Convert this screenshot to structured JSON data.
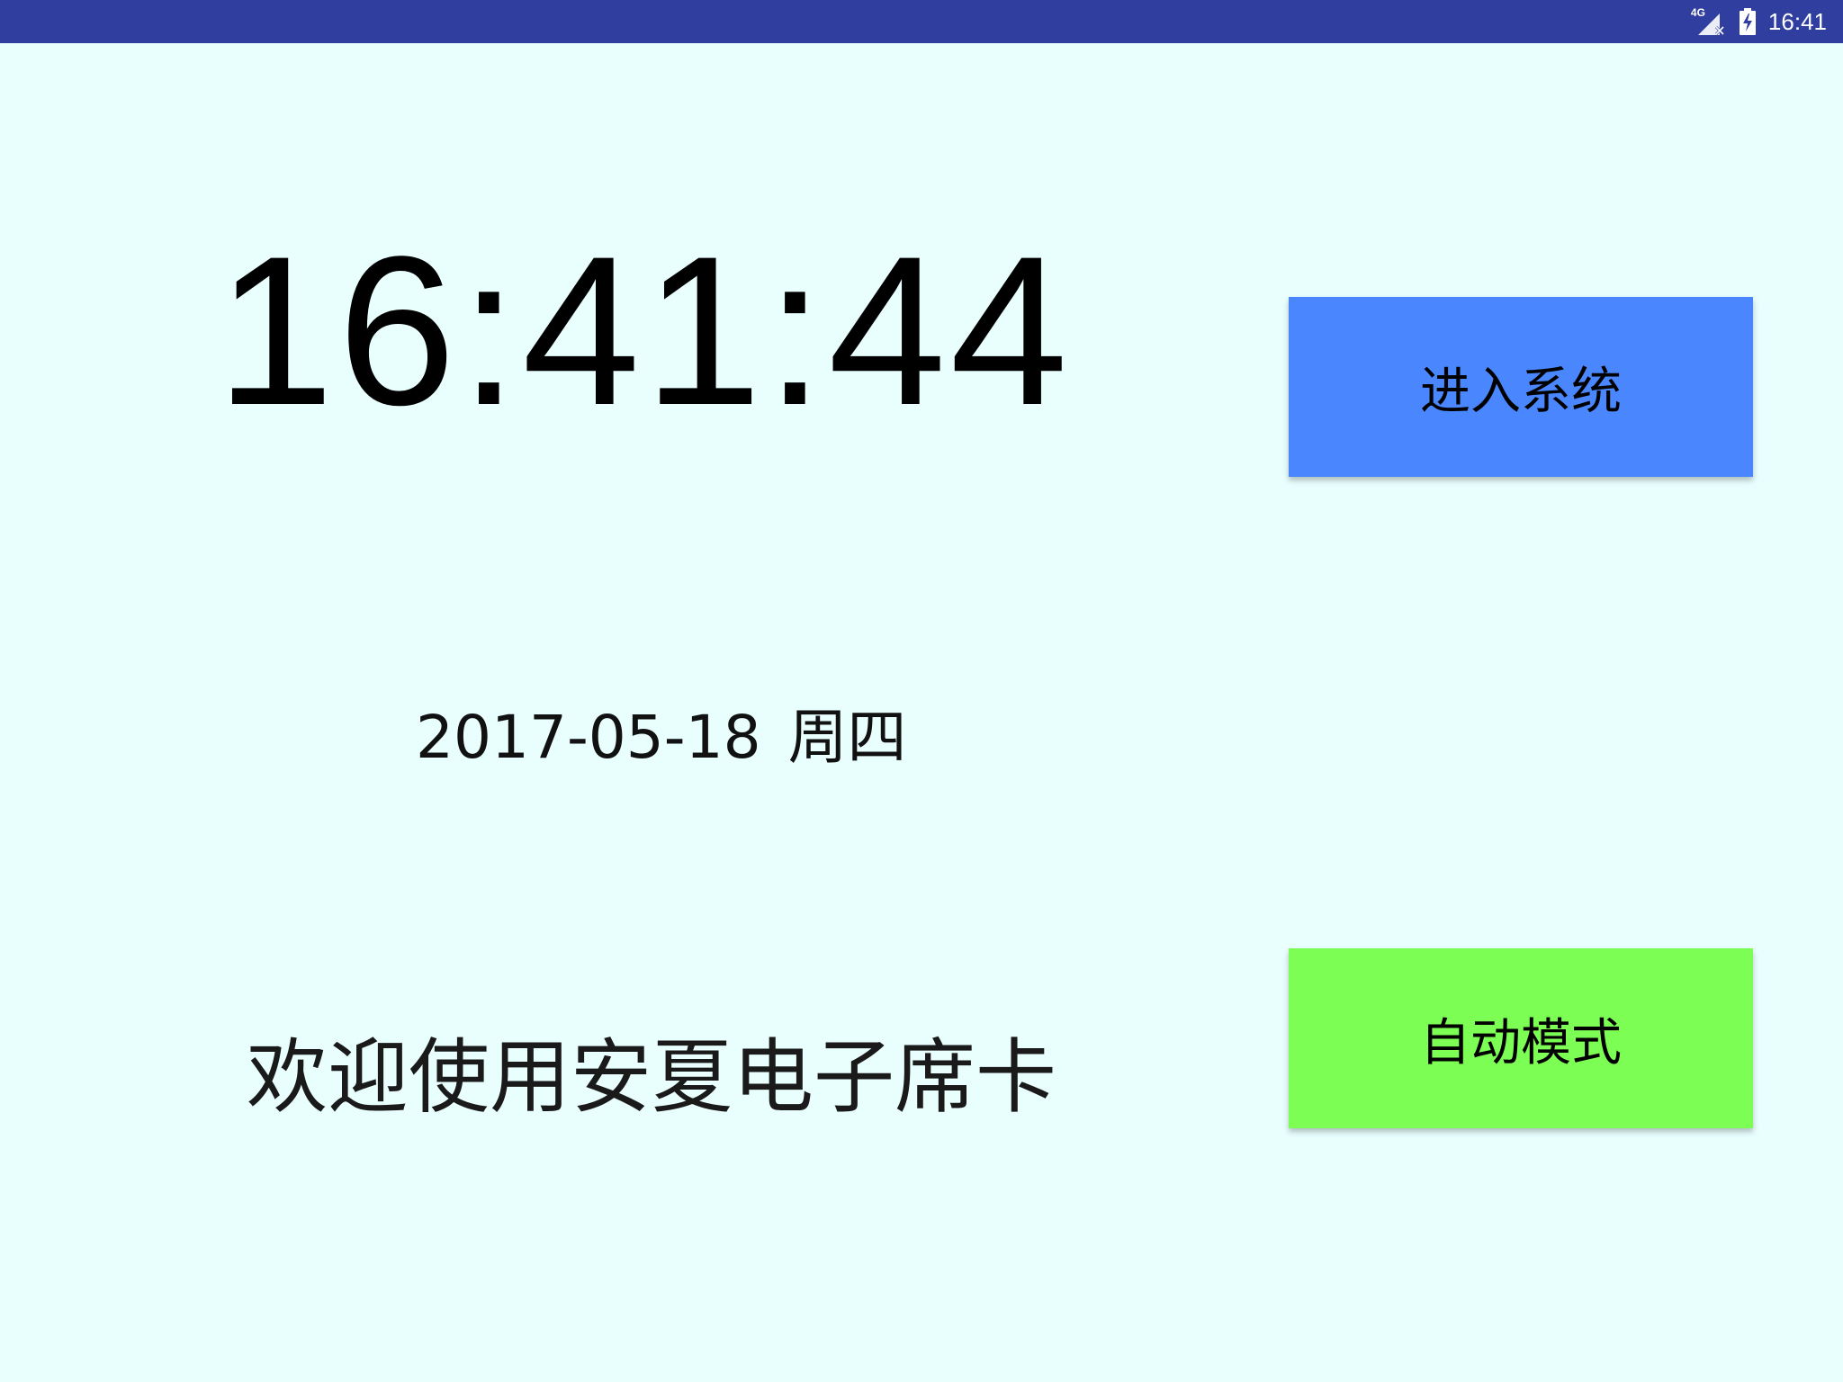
{
  "status_bar": {
    "network_type": "4G",
    "time": "16:41",
    "background": "#303f9f",
    "icons": [
      "signal-no-data-icon",
      "battery-charging-icon"
    ]
  },
  "main": {
    "clock_time": "16:41:44",
    "date": "2017-05-18",
    "weekday": "周四",
    "welcome": "欢迎使用安夏电子席卡",
    "background": "#e9fffe"
  },
  "buttons": {
    "enter_system": {
      "label": "进入系统",
      "color": "#4a87fe"
    },
    "auto_mode": {
      "label": "自动模式",
      "color": "#7cfe54"
    }
  }
}
